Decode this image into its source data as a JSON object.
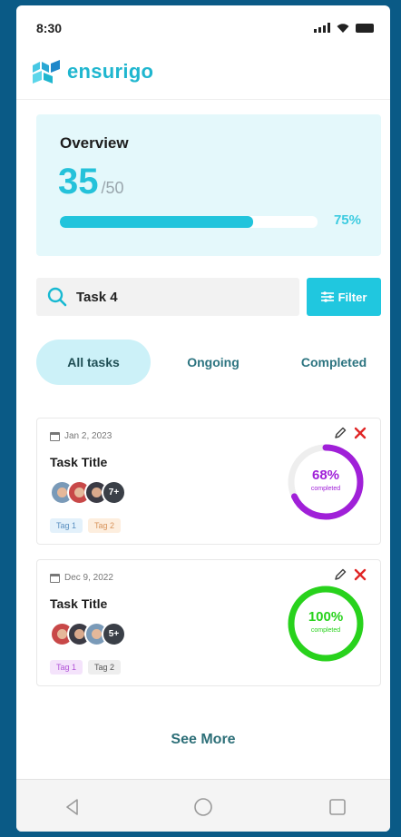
{
  "status_bar": {
    "time": "8:30"
  },
  "brand": {
    "name": "ensurigo",
    "color": "#1fb6cf"
  },
  "overview": {
    "title": "Overview",
    "done": "35",
    "total": "/50",
    "progress_percent": 75,
    "progress_label": "75%"
  },
  "search": {
    "value": "Task 4",
    "placeholder": ""
  },
  "filter": {
    "label": "Filter"
  },
  "tabs": [
    {
      "label": "All tasks",
      "active": true
    },
    {
      "label": "Ongoing",
      "active": false
    },
    {
      "label": "Completed",
      "active": false
    }
  ],
  "tasks": [
    {
      "date": "Jan 2, 2023",
      "title": "Task Title",
      "more_count": "7+",
      "tags": [
        "Tag 1",
        "Tag 2"
      ],
      "percent": 68,
      "percent_label": "68%",
      "status_label": "completed",
      "ring_color": "#a020d8"
    },
    {
      "date": "Dec 9, 2022",
      "title": "Task Title",
      "more_count": "5+",
      "tags": [
        "Tag 1",
        "Tag 2"
      ],
      "percent": 100,
      "percent_label": "100%",
      "status_label": "completed",
      "ring_color": "#28d21c"
    }
  ],
  "see_more": {
    "label": "See More"
  }
}
